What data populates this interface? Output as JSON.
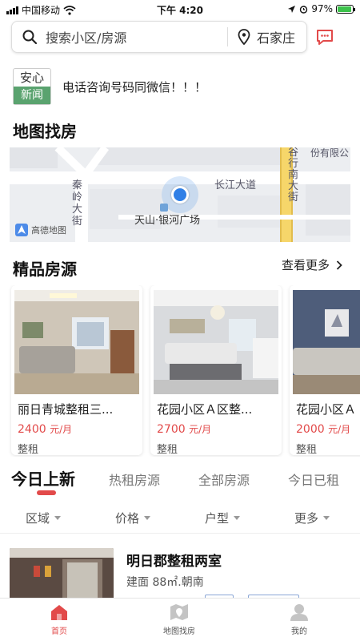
{
  "status_bar": {
    "carrier": "中国移动",
    "time": "下午 4:20",
    "battery": "97%",
    "battery_level": 0.97
  },
  "search": {
    "placeholder": "搜索小区/房源",
    "city": "石家庄",
    "icons": {
      "search": "search-icon",
      "location": "location-pin-icon",
      "message": "message-icon"
    }
  },
  "notice": {
    "logo_top": "安心",
    "logo_bottom": "新闻",
    "text": "电话咨询号码同微信！！！"
  },
  "map_section": {
    "title": "地图找房",
    "map_labels": {
      "road_left": "秦岭大街",
      "road_right": "长江大道",
      "road_vertical": "谷行南大街",
      "place": "天山·银河广场",
      "corner": "份有限公",
      "provider": "高德地图"
    }
  },
  "featured": {
    "title": "精品房源",
    "more": "查看更多",
    "cards": [
      {
        "title": "丽日青城整租三...",
        "price": "2400",
        "unit": "元/月",
        "type": "整租"
      },
      {
        "title": "花园小区Ａ区整...",
        "price": "2700",
        "unit": "元/月",
        "type": "整租"
      },
      {
        "title": "花园小区Ａ",
        "price": "2000",
        "unit": "元/月",
        "type": "整租"
      }
    ]
  },
  "tabs": [
    {
      "label": "今日上新"
    },
    {
      "label": "热租房源"
    },
    {
      "label": "全部房源"
    },
    {
      "label": "今日已租"
    }
  ],
  "filters": [
    {
      "label": "区域"
    },
    {
      "label": "价格"
    },
    {
      "label": "户型"
    },
    {
      "label": "更多"
    }
  ],
  "listing": {
    "title": "明日郡整租两室",
    "subtitle": "建面 88㎡.朝南"
  },
  "bottom_nav": [
    {
      "label": "首页",
      "icon": "home-icon"
    },
    {
      "label": "地图找房",
      "icon": "map-icon"
    },
    {
      "label": "我的",
      "icon": "user-icon"
    }
  ],
  "colors": {
    "accent": "#e24a4a",
    "logo_green": "#5aa36f",
    "map_user_dot": "#2f7fe6"
  }
}
